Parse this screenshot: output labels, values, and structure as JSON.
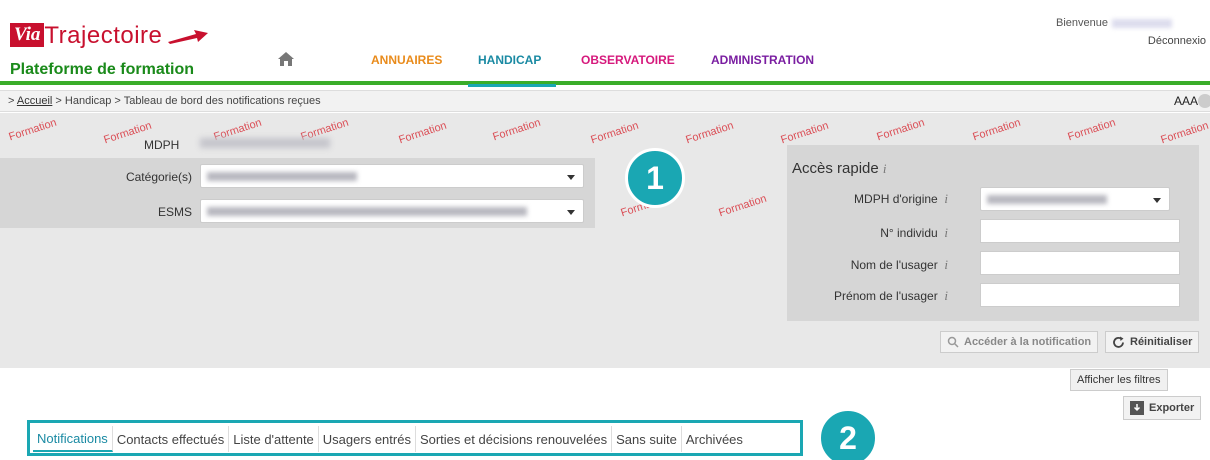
{
  "header": {
    "logo_via": "Via",
    "logo_trajectoire": "Trajectoire",
    "plateforme": "Plateforme de formation",
    "welcome": "Bienvenue",
    "logout": "Déconnexio",
    "nav": [
      "ANNUAIRES",
      "HANDICAP",
      "OBSERVATOIRE",
      "ADMINISTRATION"
    ]
  },
  "breadcrumb": {
    "prefix": ">",
    "home": "Accueil",
    "rest": "> Handicap > Tableau de bord des notifications reçues",
    "font_ctrl": "AAA"
  },
  "watermark_text": "Formation",
  "filters": {
    "mdph_label": "MDPH",
    "categorie_label": "Catégorie(s)",
    "esms_label": "ESMS"
  },
  "acces_rapide": {
    "title": "Accès rapide",
    "info": "i",
    "mdph_origine": "MDPH d'origine",
    "individu": "N° individu",
    "nom": "Nom de l'usager",
    "prenom": "Prénom de l'usager"
  },
  "buttons": {
    "acceder": "Accéder à la notification",
    "reinit": "Réinitialiser",
    "filtres": "Afficher les filtres",
    "exporter": "Exporter"
  },
  "badges": {
    "one": "1",
    "two": "2"
  },
  "tabs": [
    "Notifications",
    "Contacts effectués",
    "Liste d'attente",
    "Usagers entrés",
    "Sorties et décisions renouvelées",
    "Sans suite",
    "Archivées"
  ],
  "colors": {
    "accent": "#1aa7b3",
    "green": "#3aad2a",
    "brand_red": "#c8102e"
  }
}
